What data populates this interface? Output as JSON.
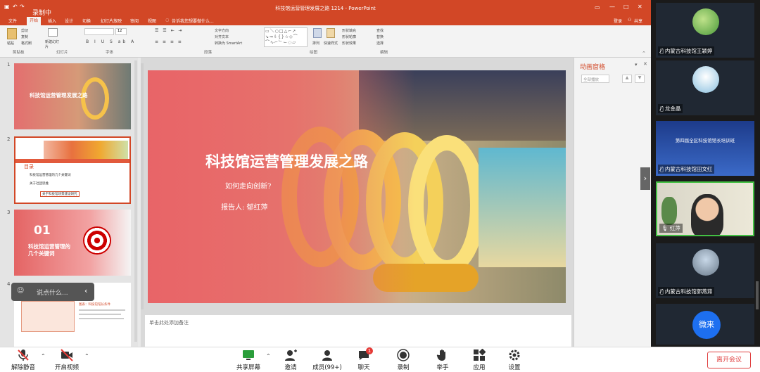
{
  "ppt": {
    "title": "科技馆运营管理发展之路 1214 - PowerPoint",
    "recording": "录制中",
    "login": "登录",
    "share": "共享",
    "tabs": [
      "文件",
      "开始",
      "插入",
      "设计",
      "切换",
      "幻灯片放映",
      "审阅",
      "视图"
    ],
    "tell_me": "告诉我您想要做什么...",
    "ribbon": {
      "clipboard": "剪贴板",
      "paste": "粘贴",
      "cut": "剪切",
      "copy": "复制",
      "format_painter": "格式刷",
      "new_slide": "新建幻灯片",
      "slides": "幻灯片",
      "font": "字体",
      "font_size": "12",
      "paragraph": "段落",
      "text_dir": "文字方向",
      "align_text": "对齐文本",
      "smartart": "转换为 SmartArt",
      "drawing": "绘图",
      "arrange": "排列",
      "quick_styles": "快速样式",
      "fill": "形状填充",
      "outline": "形状轮廓",
      "effects": "形状效果",
      "find": "查找",
      "replace": "替换",
      "select": "选择",
      "editing": "编辑"
    },
    "slide_numbers": [
      "1",
      "2",
      "3",
      "4"
    ],
    "thumbs": {
      "t1_title": "科技馆运营管理发展之路",
      "t2_heading": "目录",
      "t2_items": [
        "科技馆运营管理的几个关键词",
        "关于社团思维",
        "关于科技馆场景建设研究"
      ],
      "t3_num": "01",
      "t3_title": "科技馆运营管理的几个关键词",
      "t4_title": "图表：科技馆馆长条件"
    },
    "slide": {
      "title": "科技馆运营管理发展之路",
      "subtitle": "如何走向创新?",
      "reporter": "报告人: 郁红萍"
    },
    "notes_placeholder": "单击此处添加备注",
    "anim_pane": {
      "title": "动画窗格",
      "play": "全部播放"
    }
  },
  "chat_prompt": "说点什么...",
  "participants": [
    {
      "name": "内蒙古科技馆王颖婷"
    },
    {
      "name": "龙金晶"
    },
    {
      "name": "内蒙古科技馆田文红",
      "banner": "第四届全区科技馆馆长培训班"
    },
    {
      "name": "红萍"
    },
    {
      "name": "内蒙古科技馆郭燕茹"
    },
    {
      "name": "",
      "badge": "微来"
    }
  ],
  "toolbar": {
    "mute": "解除静音",
    "video": "开启视频",
    "share_screen": "共享屏幕",
    "invite": "邀请",
    "members": "成员(99+)",
    "chat": "聊天",
    "chat_badge": "1",
    "record": "录制",
    "raise_hand": "举手",
    "apps": "应用",
    "settings": "设置",
    "leave": "离开会议"
  },
  "colors": {
    "ppt_accent": "#d24726",
    "leave_red": "#e04040"
  }
}
